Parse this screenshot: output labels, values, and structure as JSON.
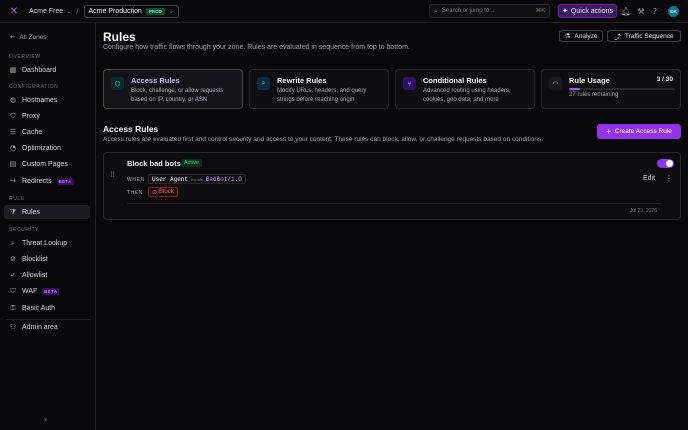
{
  "topbar": {
    "account": "Acme Free",
    "zone": "Acme Production",
    "zone_badge": "PROD",
    "search_placeholder": "Search or jump to...",
    "search_shortcut": "⌘K",
    "quick_actions": "Quick actions",
    "avatar_initials": "DK"
  },
  "sidebar": {
    "all_zones": "All Zones",
    "sections": {
      "overview": "OVERVIEW",
      "configuration": "CONFIGURATION",
      "rule": "RULE",
      "security": "SECURITY"
    },
    "items": {
      "dashboard": "Dashboard",
      "hostnames": "Hostnames",
      "proxy": "Proxy",
      "cache": "Cache",
      "optimization": "Optimization",
      "custom_pages": "Custom Pages",
      "redirects": "Redirects",
      "rules": "Rules",
      "threat_lookup": "Threat Lookup",
      "blocklist": "Blocklist",
      "allowlist": "Allowlist",
      "waf": "WAF",
      "basic_auth": "Basic Auth",
      "admin_area": "Admin area"
    },
    "beta_label": "BETA"
  },
  "page": {
    "title": "Rules",
    "subtitle": "Configure how traffic flows through your zone. Rules are evaluated in sequence from top to bottom.",
    "analyze": "Analyze",
    "traffic_sequence": "Traffic Sequence"
  },
  "cards": [
    {
      "title": "Access Rules",
      "desc": "Block, challenge, or allow requests based on IP, country, or ASN"
    },
    {
      "title": "Rewrite Rules",
      "desc": "Modify URLs, headers, and query strings before reaching origin"
    },
    {
      "title": "Conditional Rules",
      "desc": "Advanced routing using headers, cookies, geo data, and more"
    }
  ],
  "usage": {
    "title": "Rule Usage",
    "count": "3 / 30",
    "remaining": "27 rules remaining",
    "fraction": 0.1
  },
  "access": {
    "title": "Access Rules",
    "subtitle": "Access rules are evaluated first and control security and access to your content. These rules can block, allow, or challenge requests based on conditions.",
    "create": "Create Access Rule"
  },
  "rule": {
    "name": "Block bad bots",
    "status": "Active",
    "when_label": "WHEN",
    "then_label": "THEN",
    "field": "User Agent",
    "operator": "equals",
    "value": "BadBot/1.0",
    "action": "Block",
    "date": "Jul 23, 2026",
    "edit": "Edit"
  },
  "colors": {
    "accent": "#9333ea",
    "background": "#09090b",
    "active": "#4ade80",
    "danger": "#f87171"
  }
}
